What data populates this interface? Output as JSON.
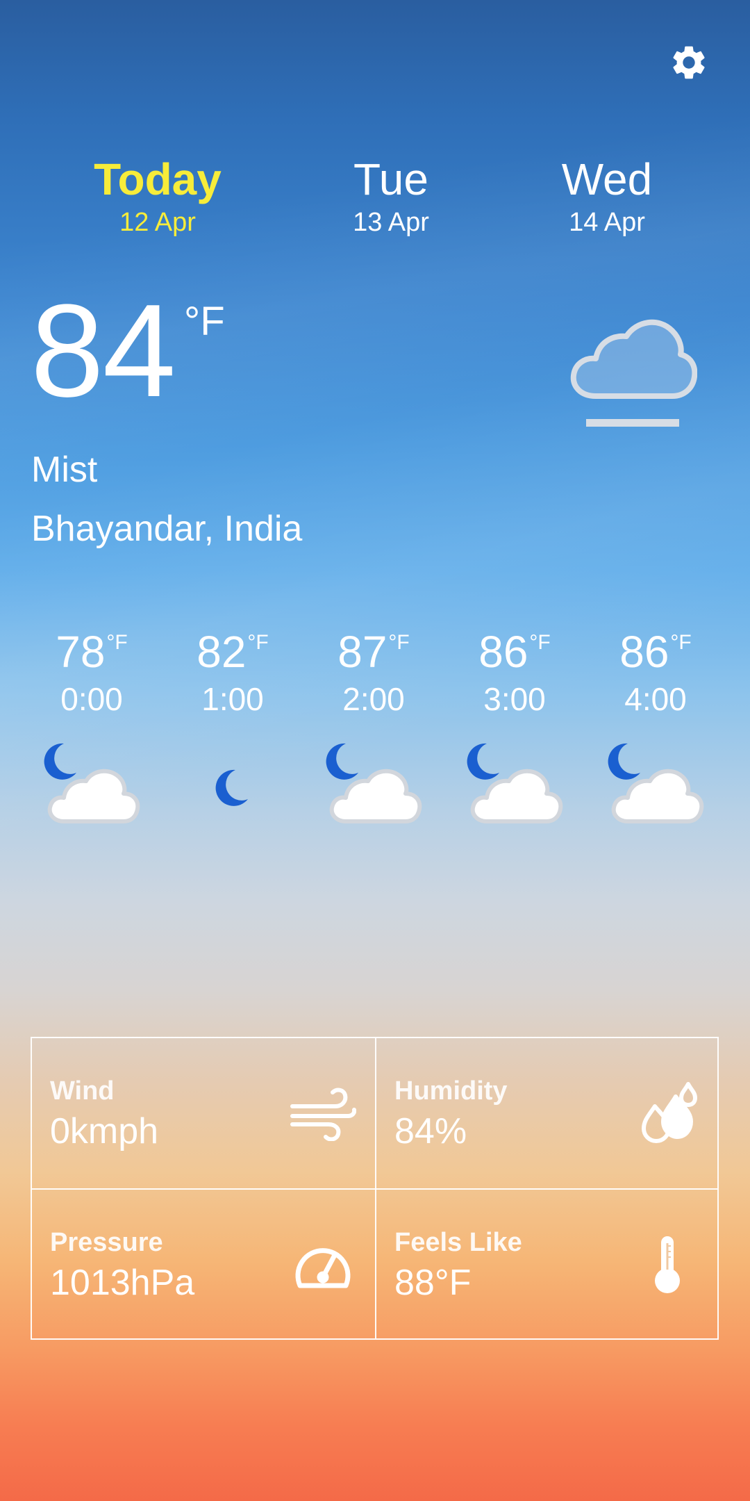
{
  "settings": {
    "icon": "gear-icon"
  },
  "days": [
    {
      "name": "Today",
      "date": "12 Apr",
      "active": true
    },
    {
      "name": "Tue",
      "date": "13 Apr",
      "active": false
    },
    {
      "name": "Wed",
      "date": "14 Apr",
      "active": false
    }
  ],
  "current": {
    "temp": "84",
    "unit": "°F",
    "condition": "Mist",
    "location": "Bhayandar, India",
    "icon": "mist-icon"
  },
  "hourly": [
    {
      "temp": "78",
      "unit": "°F",
      "time": "0:00",
      "icon": "partly-cloudy-night-icon"
    },
    {
      "temp": "82",
      "unit": "°F",
      "time": "1:00",
      "icon": "moon-icon"
    },
    {
      "temp": "87",
      "unit": "°F",
      "time": "2:00",
      "icon": "partly-cloudy-night-icon"
    },
    {
      "temp": "86",
      "unit": "°F",
      "time": "3:00",
      "icon": "partly-cloudy-night-icon"
    },
    {
      "temp": "86",
      "unit": "°F",
      "time": "4:00",
      "icon": "partly-cloudy-night-icon"
    }
  ],
  "details": {
    "wind": {
      "label": "Wind",
      "value": "0kmph",
      "icon": "wind-icon"
    },
    "humidity": {
      "label": "Humidity",
      "value": "84%",
      "icon": "humidity-icon"
    },
    "pressure": {
      "label": "Pressure",
      "value": "1013hPa",
      "icon": "pressure-gauge-icon"
    },
    "feels_like": {
      "label": "Feels Like",
      "value": "88°F",
      "icon": "thermometer-icon"
    }
  },
  "colors": {
    "active_day": "#f7ec3a",
    "moon": "#1a5fd0",
    "text": "#ffffff"
  }
}
